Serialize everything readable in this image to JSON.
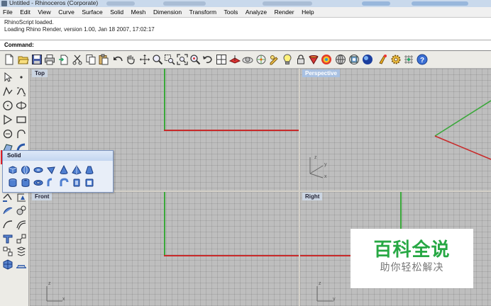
{
  "window": {
    "title": "Untitled - Rhinoceros (Corporate)"
  },
  "menu": [
    "File",
    "Edit",
    "View",
    "Curve",
    "Surface",
    "Solid",
    "Mesh",
    "Dimension",
    "Transform",
    "Tools",
    "Analyze",
    "Render",
    "Help"
  ],
  "history": {
    "line1": "RhinoScript loaded.",
    "line2": "Loading Rhino Render, version 1.00, Jan 18 2007, 17:02:17"
  },
  "command": {
    "label": "Command:",
    "value": ""
  },
  "toolbar": [
    "new-icon",
    "open-icon",
    "save-icon",
    "print-icon",
    "import-icon",
    "cut-icon",
    "copy-icon",
    "paste-icon",
    "undo-icon",
    "pan-hand-icon",
    "rotate-view-icon",
    "zoom-icon",
    "zoom-window-icon",
    "zoom-extents-icon",
    "zoom-selected-icon",
    "undo-view-icon",
    "four-viewports-icon",
    "cplane-icon",
    "sphere-view-icon",
    "osnap-icon",
    "properties-icon",
    "light-icon",
    "layer-lock-icon",
    "shade-icon",
    "render-color-icon",
    "rendered-icon",
    "render-icon",
    "render-preview-icon",
    "material-icon",
    "options-gear-icon",
    "grid-snap-icon",
    "help-icon"
  ],
  "sidebar": {
    "selected": "solid-box-icon",
    "col1": [
      "select-arrow-icon",
      "polyline-icon",
      "circle-icon",
      "polygon-icon",
      "ellipse-icon",
      "surface-icon",
      "solid-box-icon",
      "cylinder-icon",
      "mesh-icon",
      "extend-icon",
      "fillet-icon",
      "trim-icon",
      "join-icon",
      "group-icon",
      "explode-icon",
      "mesh-sphere-icon"
    ],
    "col2": [
      "point-icon",
      "curve-icon",
      "arc-icon",
      "rectangle-icon",
      "freeform-icon",
      "loft-icon",
      "",
      "",
      "",
      "dimension-icon",
      "boolean-icon",
      "offset-icon",
      "snap-icon",
      "array-icon",
      "mirror-icon",
      "grid-icon"
    ]
  },
  "viewports": {
    "top": {
      "label": "Top"
    },
    "perspective": {
      "label": "Perspective"
    },
    "front": {
      "label": "Front"
    },
    "right": {
      "label": "Right"
    }
  },
  "axis_labels": {
    "x": "x",
    "y": "y",
    "z": "z"
  },
  "flyout": {
    "title": "Solid",
    "row1": [
      "box-icon",
      "sphere-icon",
      "ellipsoid-icon",
      "paraboloid-icon",
      "cone-icon",
      "pyramid-icon",
      "truncated-cone-icon"
    ],
    "row2": [
      "cylinder-icon",
      "tube-icon",
      "torus-icon",
      "pipe-icon",
      "pipe-round-icon",
      "extrude-icon",
      "slab-icon"
    ]
  },
  "watermark": {
    "brand": "百科全说",
    "tagline": "助你轻松解决"
  },
  "colors": {
    "x_axis": "#c82a2a",
    "y_axis": "#3aa83a",
    "grid": "#bebebe",
    "highlight": "#e0202a"
  }
}
